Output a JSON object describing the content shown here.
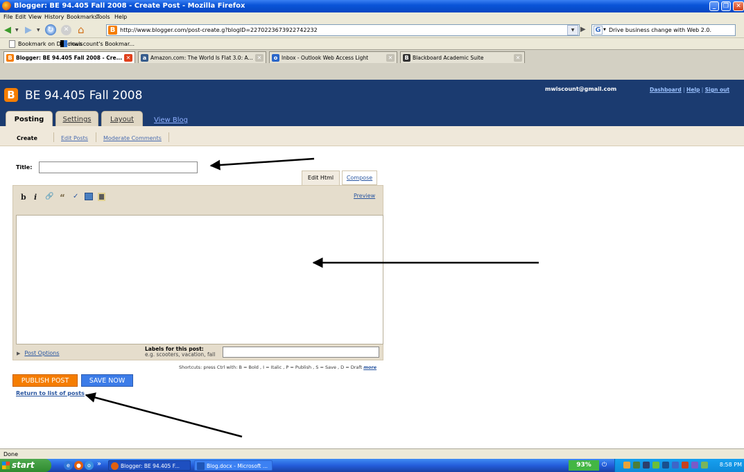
{
  "window": {
    "title": "Blogger: BE 94.405 Fall 2008 - Create Post - Mozilla Firefox",
    "controls": [
      "_",
      "❐",
      "✕"
    ]
  },
  "menu": [
    "File",
    "Edit",
    "View",
    "History",
    "Bookmarks",
    "Tools",
    "Help"
  ],
  "nav": {
    "url": "http://www.blogger.com/post-create.g?blogID=2270223673922742232",
    "search_value": "Drive business change with Web 2.0."
  },
  "bookmarks": [
    "Bookmark on Delicious",
    "mwiscount's Bookmar..."
  ],
  "tabs": [
    {
      "label": "Blogger: BE 94.405 Fall 2008 - Cre...",
      "icon": "blogger-icon",
      "active": true
    },
    {
      "label": "Amazon.com: The World Is Flat 3.0: A...",
      "icon": "amazon-icon",
      "active": false
    },
    {
      "label": "Inbox - Outlook Web Access Light",
      "icon": "outlook-icon",
      "active": false
    },
    {
      "label": "Blackboard Academic Suite",
      "icon": "blackboard-icon",
      "active": false
    }
  ],
  "blogger": {
    "blog_title": "BE 94.405 Fall 2008",
    "account": "mwiscount@gmail.com",
    "header_links": [
      "Dashboard",
      "Help",
      "Sign out"
    ],
    "main_tabs": [
      "Posting",
      "Settings",
      "Layout"
    ],
    "view_blog": "View Blog",
    "sub_tabs": [
      "Create",
      "Edit Posts",
      "Moderate Comments"
    ],
    "accent_color": "#f57d00"
  },
  "editor": {
    "title_label": "Title:",
    "title_value": "",
    "mode_tabs": [
      "Edit Html",
      "Compose"
    ],
    "active_mode": "Edit Html",
    "toolbar": [
      "b",
      "i",
      "link-icon",
      "quote-icon",
      "spellcheck-icon",
      "image-icon",
      "video-icon"
    ],
    "preview": "Preview",
    "body_value": "",
    "post_options": "Post Options",
    "labels_label": "Labels for this post:",
    "labels_example": "e.g. scooters, vacation, fall",
    "labels_value": "",
    "shortcuts_text": "Shortcuts: press Ctrl with: B = Bold , I = Italic , P = Publish , S = Save , D = Draft",
    "shortcuts_more": "more",
    "publish_button": "PUBLISH POST",
    "save_button": "SAVE NOW",
    "return_link": "Return to list of posts"
  },
  "status": "Done",
  "taskbar": {
    "start": "start",
    "items": [
      "Blogger: BE 94.405 F...",
      "Blog.docx - Microsoft ..."
    ],
    "battery": "93%",
    "clock": "8:58 PM"
  }
}
